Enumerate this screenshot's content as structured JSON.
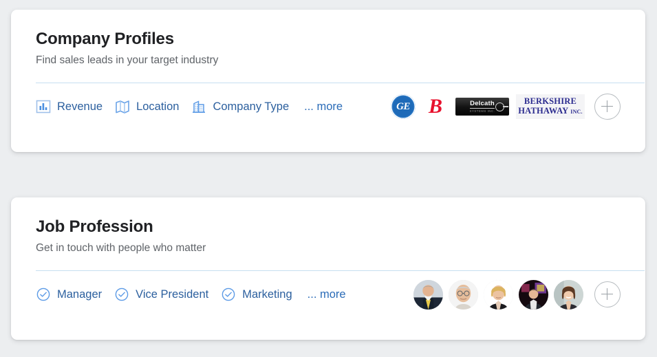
{
  "background_color": "#eceef0",
  "accent_color": "#2b6cb8",
  "cards": [
    {
      "id": "company-profiles",
      "title": "Company Profiles",
      "subtitle": "Find sales leads in your target industry",
      "tags": [
        {
          "label": "Revenue",
          "icon": "bar-chart-icon"
        },
        {
          "label": "Location",
          "icon": "map-icon"
        },
        {
          "label": "Company Type",
          "icon": "office-building-icon"
        }
      ],
      "more_label": "... more",
      "logos": [
        {
          "name": "general-electric-logo",
          "text": "GE",
          "color": "#1e6ab8"
        },
        {
          "name": "b-logo",
          "text": "B",
          "color": "#e8112d"
        },
        {
          "name": "delcath-logo",
          "text": "Delcath",
          "subtext": "SYSTEMS   INC.",
          "color": "#111111"
        },
        {
          "name": "berkshire-hathaway-logo",
          "line1": "BERKSHIRE",
          "line2": "HATHAWAY",
          "suffix": "INC.",
          "color": "#2b2b8f"
        }
      ],
      "add_button_label": "+"
    },
    {
      "id": "job-profession",
      "title": "Job Profession",
      "subtitle": "Get in touch with people who matter",
      "tags": [
        {
          "label": "Manager",
          "icon": "check-circle-icon"
        },
        {
          "label": "Vice President",
          "icon": "check-circle-icon"
        },
        {
          "label": "Marketing",
          "icon": "check-circle-icon"
        }
      ],
      "more_label": "... more",
      "avatars": [
        {
          "name": "avatar-person-1",
          "alt": "man in dark suit with yellow tie"
        },
        {
          "name": "avatar-person-2",
          "alt": "older man with glasses"
        },
        {
          "name": "avatar-person-3",
          "alt": "blonde woman in black blazer"
        },
        {
          "name": "avatar-person-4",
          "alt": "man speaking on stage"
        },
        {
          "name": "avatar-person-5",
          "alt": "smiling woman with brown hair"
        }
      ],
      "add_button_label": "+"
    }
  ]
}
